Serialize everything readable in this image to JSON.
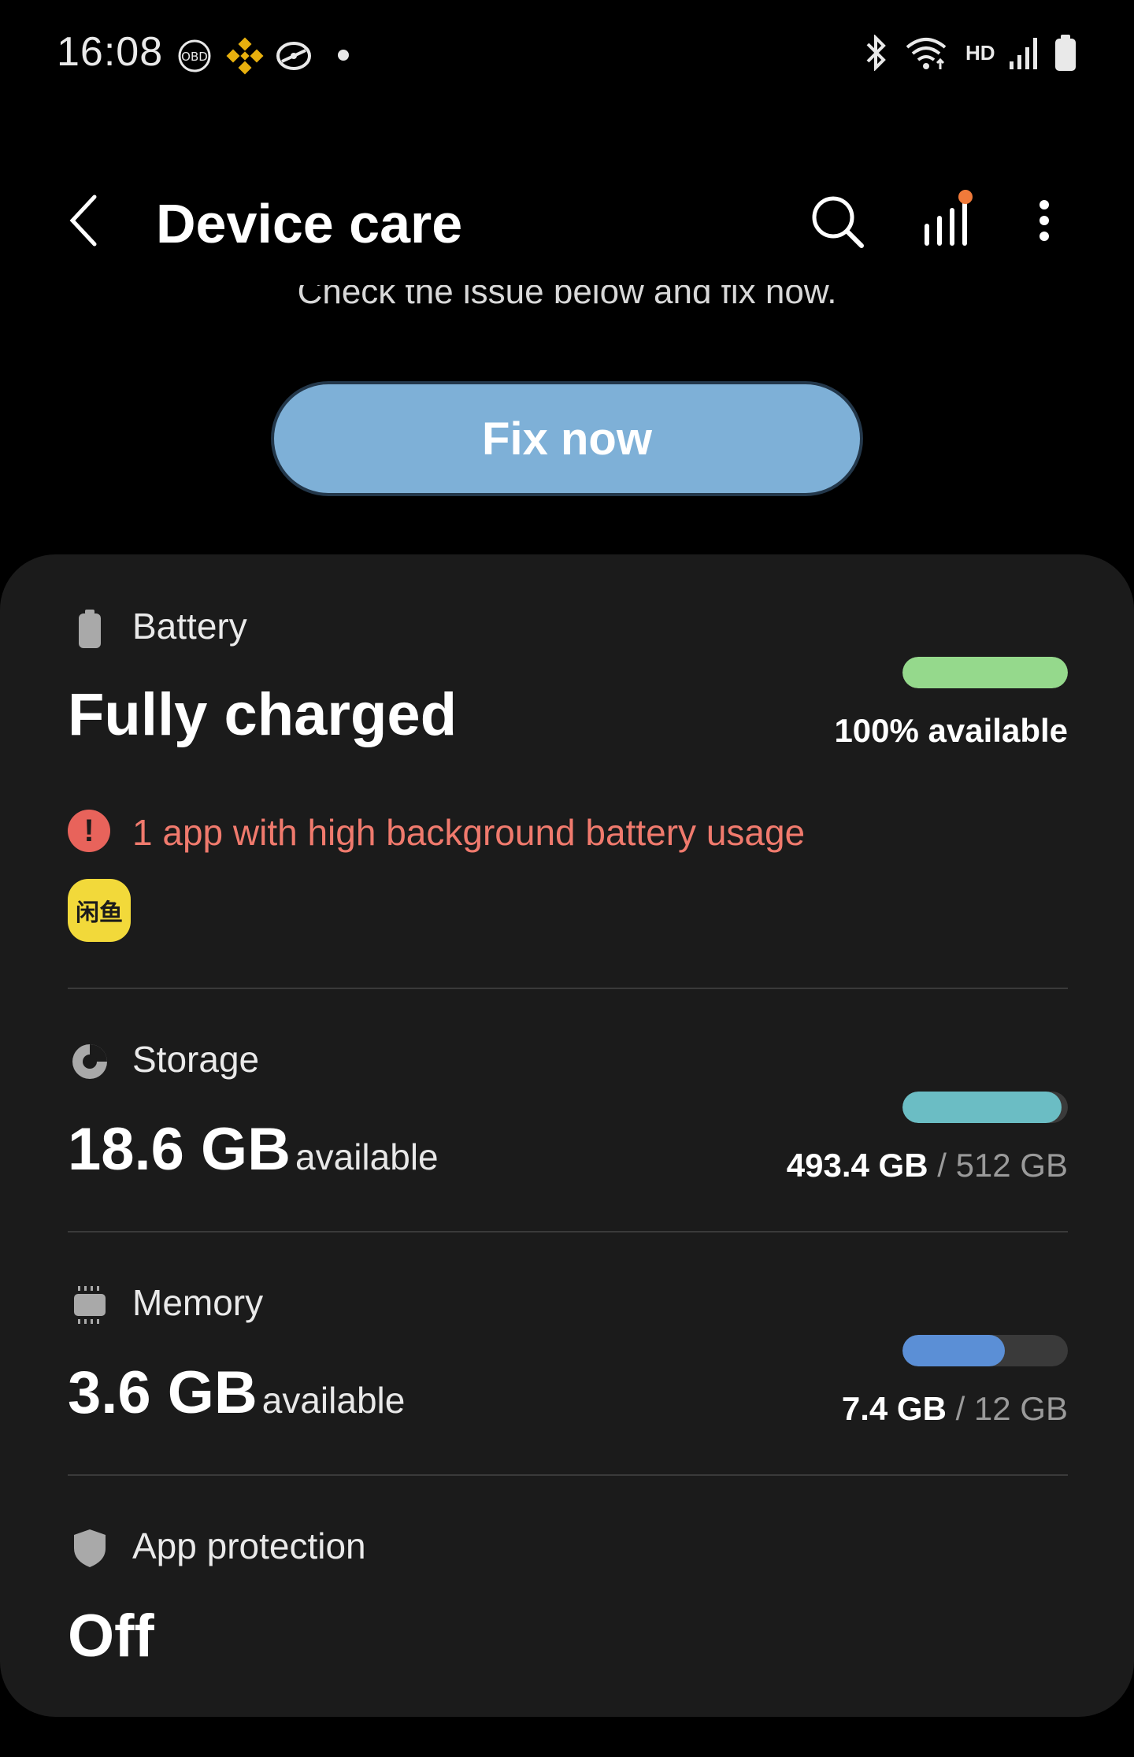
{
  "status_bar": {
    "time": "16:08",
    "left_icons": [
      "obd-icon",
      "binance-icon",
      "sync-icon",
      "dot-icon"
    ],
    "right_icons": [
      "bluetooth-icon",
      "wifi-icon",
      "hd-icon",
      "signal-icon",
      "battery-icon"
    ],
    "hd_label": "HD"
  },
  "header": {
    "title": "Device care",
    "back_icon": "chevron-left-icon",
    "search_icon": "search-icon",
    "stats_icon": "bar-chart-icon",
    "more_icon": "more-vertical-icon"
  },
  "intro": {
    "message": "Check the issue below and fix now."
  },
  "fix_button": {
    "label": "Fix now"
  },
  "battery": {
    "label": "Battery",
    "status": "Fully charged",
    "level_text": "100% available",
    "level_fraction": 1.0,
    "bar_color": "#95d98c",
    "warning": "1 app with high background battery usage",
    "warning_color": "#f07a6d",
    "app_icon_text": "闲鱼"
  },
  "storage": {
    "label": "Storage",
    "value": "18.6 GB",
    "unit": "available",
    "used": "493.4 GB",
    "separator": "/",
    "total": "512 GB",
    "used_fraction": 0.964,
    "bar_color": "#6bbdc4"
  },
  "memory": {
    "label": "Memory",
    "value": "3.6 GB",
    "unit": "available",
    "used": "7.4 GB",
    "separator": "/",
    "total": "12 GB",
    "used_fraction": 0.617,
    "bar_color": "#5b8fd6"
  },
  "app_protection": {
    "label": "App protection",
    "status": "Off"
  }
}
